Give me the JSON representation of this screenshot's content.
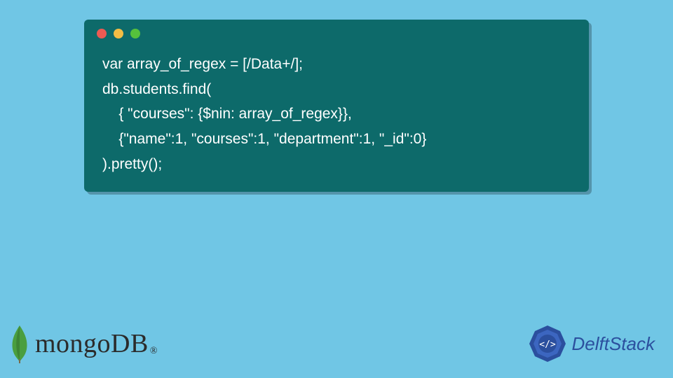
{
  "code": {
    "line1": "var array_of_regex = [/Data+/];",
    "line2": "db.students.find(",
    "line3": "    { \"courses\": {$nin: array_of_regex}},",
    "line4": "    {\"name\":1, \"courses\":1, \"department\":1, \"_id\":0}",
    "line5": ").pretty();"
  },
  "logos": {
    "mongo": "mongoDB",
    "mongo_reg": "®",
    "delft": "DelftStack"
  },
  "colors": {
    "background": "#70c6e5",
    "window": "#0d6a6a",
    "code_text": "#ffffff"
  }
}
